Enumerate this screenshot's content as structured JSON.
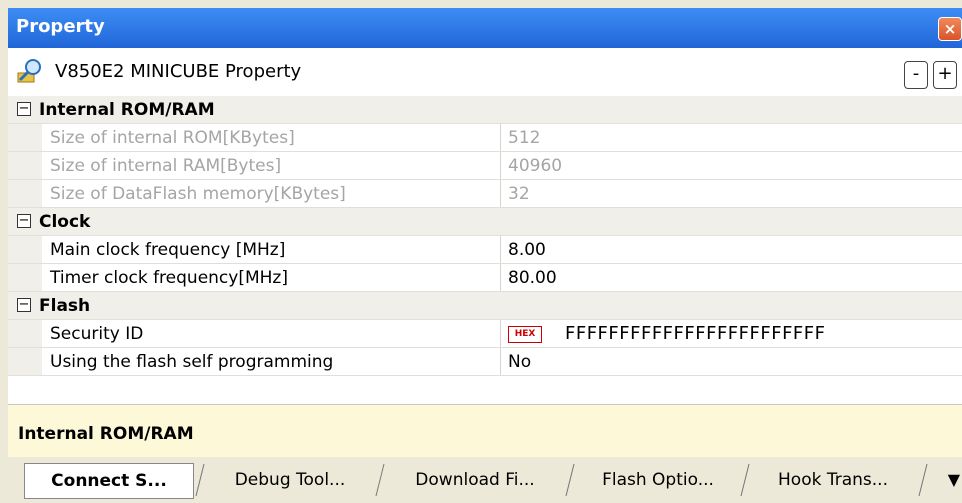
{
  "panel": {
    "title": "Property",
    "close_label": "×"
  },
  "header": {
    "title": "V850E2 MINICUBE Property",
    "minus_label": "-",
    "plus_label": "+"
  },
  "categories": [
    {
      "name": "Internal ROM/RAM",
      "toggle": "−",
      "rows": [
        {
          "name": "Size of internal ROM[KBytes]",
          "value": "512"
        },
        {
          "name": "Size of internal RAM[Bytes]",
          "value": "40960"
        },
        {
          "name": "Size of DataFlash memory[KBytes]",
          "value": "32"
        }
      ]
    },
    {
      "name": "Clock",
      "toggle": "−",
      "rows": [
        {
          "name": "Main clock frequency [MHz]",
          "value": "8.00"
        },
        {
          "name": "Timer clock frequency[MHz]",
          "value": "80.00"
        }
      ]
    },
    {
      "name": "Flash",
      "toggle": "−",
      "rows": [
        {
          "name": "Security ID",
          "badge": "HEX",
          "value": "FFFFFFFFFFFFFFFFFFFFFFFF"
        },
        {
          "name": "Using the flash self programming",
          "value": "No"
        }
      ]
    }
  ],
  "description": {
    "text": "Internal ROM/RAM"
  },
  "tabs": [
    {
      "label": "Connect S..."
    },
    {
      "label": "Debug Tool..."
    },
    {
      "label": "Download Fi..."
    },
    {
      "label": "Flash Optio..."
    },
    {
      "label": "Hook Trans..."
    }
  ],
  "tab_overflow_icon": "▼"
}
